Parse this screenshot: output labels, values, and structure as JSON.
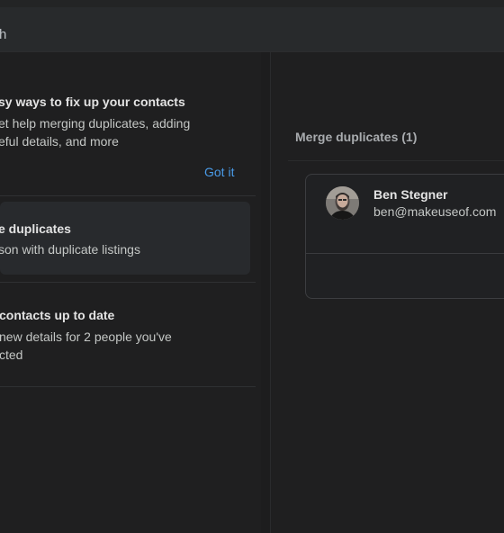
{
  "search": {
    "partial_text": "h"
  },
  "tips": {
    "title": "Easy ways to fix up your contacts",
    "title_visible": "sy ways to fix up your contacts",
    "desc_line1": "et help merging duplicates, adding",
    "desc_line2": "eful details, and more",
    "got_it_label": "Got it"
  },
  "duplicates_card": {
    "title": "e duplicates",
    "desc": "son with duplicate listings"
  },
  "update_card": {
    "title": "contacts up to date",
    "desc_line1": "new details for 2 people you've",
    "desc_line2": "cted"
  },
  "merge_panel": {
    "header": "Merge duplicates (1)",
    "contact": {
      "name": "Ben Stegner",
      "email": "ben@makeuseof.com"
    }
  },
  "colors": {
    "background": "#1f1f20",
    "accent": "#4a9be8",
    "card": "#282a2d"
  }
}
